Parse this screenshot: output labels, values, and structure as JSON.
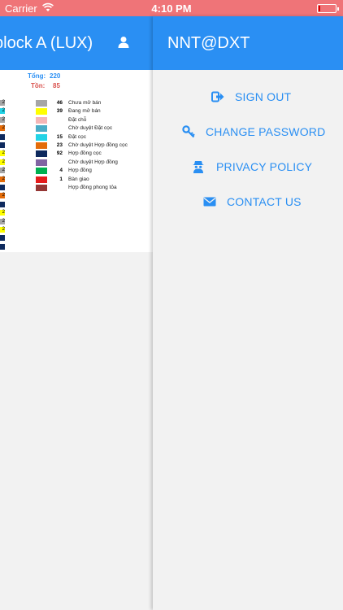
{
  "status_bar": {
    "carrier": "Carrier",
    "time": "4:10 PM"
  },
  "left_panel": {
    "title": "block A (LUX)",
    "total_label": "Tổng:",
    "total_value": "220",
    "remaining_label": "Tồn:",
    "remaining_value": "85",
    "legend": [
      {
        "color": "#a6a6a6",
        "count": "46",
        "label": "Chưa mở bán"
      },
      {
        "color": "#ffff00",
        "count": "39",
        "label": "Đang mở bán"
      },
      {
        "color": "#f4b6b6",
        "count": "",
        "label": "Đặt chỗ"
      },
      {
        "color": "#4aacc6",
        "count": "",
        "label": "Chờ duyệt Đặt cọc"
      },
      {
        "color": "#22d3e6",
        "count": "15",
        "label": "Đặt cọc"
      },
      {
        "color": "#e46c0a",
        "count": "23",
        "label": "Chờ duyệt Hợp đồng cọc"
      },
      {
        "color": "#0e2a5e",
        "count": "92",
        "label": "Hợp đồng cọc"
      },
      {
        "color": "#8064a2",
        "count": "",
        "label": "Chờ duyệt Hợp đồng"
      },
      {
        "color": "#00b050",
        "count": "4",
        "label": "Hợp đồng"
      },
      {
        "color": "#e51b1b",
        "count": "1",
        "label": "Bàn giao"
      },
      {
        "color": "#953735",
        "count": "",
        "label": "Hợp đồng phong tỏa"
      }
    ],
    "edge_cells": [
      {
        "color": "#a6a6a6",
        "text": "2"
      },
      {
        "color": "#22d3e6",
        "text": "2"
      },
      {
        "color": "#a6a6a6",
        "text": "2"
      },
      {
        "color": "#e46c0a",
        "text": "2"
      },
      {
        "color": "#0e2a5e",
        "text": ""
      },
      {
        "color": "#0e2a5e",
        "text": ""
      },
      {
        "color": "#ffff00",
        "text": "2"
      },
      {
        "color": "#ffff00",
        "text": "2"
      },
      {
        "color": "#a6a6a6",
        "text": "2"
      },
      {
        "color": "#e46c0a",
        "text": "2"
      },
      {
        "color": "#0e2a5e",
        "text": ""
      },
      {
        "color": "#e46c0a",
        "text": "2"
      },
      {
        "color": "#0e2a5e",
        "text": ""
      },
      {
        "color": "#ffff00",
        "text": "2"
      },
      {
        "color": "#a6a6a6",
        "text": "2"
      },
      {
        "color": "#ffff00",
        "text": "2"
      },
      {
        "color": "#0e2a5e",
        "text": ""
      },
      {
        "color": "#0e2a5e",
        "text": ""
      }
    ]
  },
  "right_panel": {
    "title": "NNT@DXT",
    "menu": [
      {
        "icon": "sign-out-icon",
        "label": "SIGN OUT"
      },
      {
        "icon": "key-icon",
        "label": "CHANGE PASSWORD"
      },
      {
        "icon": "spy-icon",
        "label": "PRIVACY POLICY"
      },
      {
        "icon": "envelope-icon",
        "label": "CONTACT US"
      }
    ]
  },
  "colors": {
    "accent": "#2a8ff3",
    "status_bar": "#ef7478",
    "total": "#2a8ff3",
    "remaining": "#d9534f"
  }
}
